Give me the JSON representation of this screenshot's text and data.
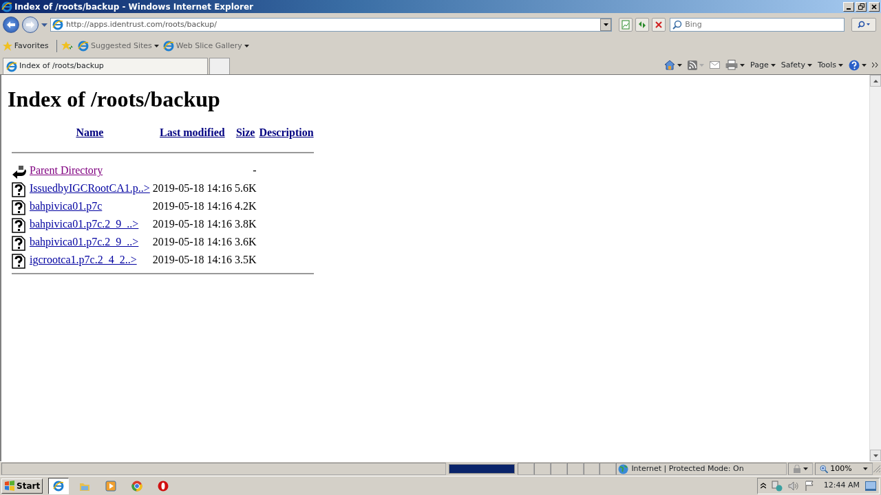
{
  "window": {
    "title": "Index of /roots/backup - Windows Internet Explorer"
  },
  "address": {
    "url": "http://apps.identrust.com/roots/backup/"
  },
  "search": {
    "placeholder": "Bing"
  },
  "favorites_bar": {
    "label": "Favorites",
    "links": [
      "Suggested Sites",
      "Web Slice Gallery"
    ]
  },
  "tabs": [
    {
      "label": "Index of /roots/backup",
      "selected": true
    }
  ],
  "command_bar": [
    "Page",
    "Safety",
    "Tools"
  ],
  "page": {
    "heading": "Index of /roots/backup",
    "columns": [
      "Name",
      "Last modified",
      "Size",
      "Description"
    ],
    "rows": [
      {
        "kind": "parent",
        "name": "Parent Directory",
        "modified": "",
        "size": "-",
        "visited": true
      },
      {
        "kind": "file",
        "name": "IssuedbyIGCRootCA1.p..>",
        "modified": "2019-05-18 14:16",
        "size": "5.6K",
        "visited": false
      },
      {
        "kind": "file",
        "name": "bahpivica01.p7c",
        "modified": "2019-05-18 14:16",
        "size": "4.2K",
        "visited": false
      },
      {
        "kind": "file",
        "name": "bahpivica01.p7c.2_9_..>",
        "modified": "2019-05-18 14:16",
        "size": "3.8K",
        "visited": false
      },
      {
        "kind": "file",
        "name": "bahpivica01.p7c.2_9_..>",
        "modified": "2019-05-18 14:16",
        "size": "3.6K",
        "visited": false
      },
      {
        "kind": "file",
        "name": "igcrootca1.p7c.2_4_2..>",
        "modified": "2019-05-18 14:16",
        "size": "3.5K",
        "visited": false
      }
    ]
  },
  "status_bar": {
    "progress": {
      "level": 1
    },
    "zone": "Internet | Protected Mode: On",
    "zoom": "100%"
  },
  "taskbar": {
    "start": "Start",
    "apps": [
      {
        "kind": "ie",
        "selected": true
      },
      {
        "kind": "folder",
        "selected": false
      },
      {
        "kind": "media",
        "selected": false
      },
      {
        "kind": "chrome",
        "selected": false
      },
      {
        "kind": "opera",
        "selected": false
      }
    ],
    "clock": "12:44 AM"
  }
}
